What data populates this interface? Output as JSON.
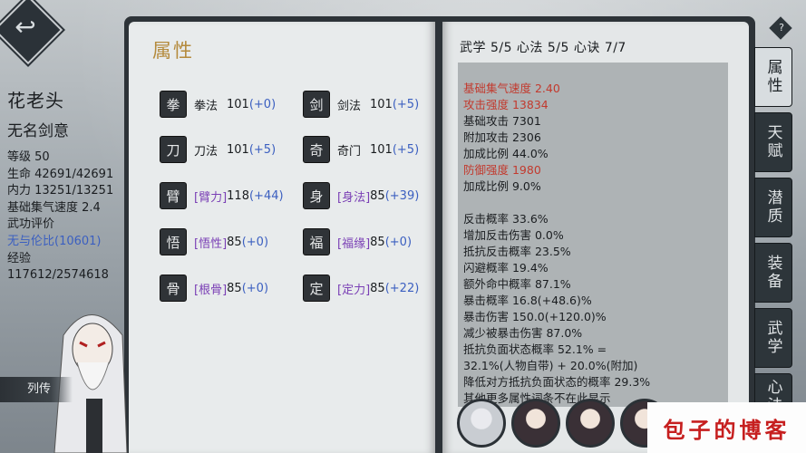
{
  "character": {
    "name": "花老头",
    "title": "无名剑意",
    "lines": [
      "等级 50",
      "生命 42691/42691",
      "内力 13251/13251",
      "基础集气速度 2.4",
      "武功评价",
      "无与伦比(10601)",
      "经验",
      "117612/2574618"
    ],
    "biography_label": "列传"
  },
  "attributes": {
    "title": "属性",
    "skills": [
      {
        "icon": "fist-icon",
        "glyph": "拳",
        "name": "拳法",
        "value": "101",
        "bonus": "(+0)",
        "special": false
      },
      {
        "icon": "sword-icon",
        "glyph": "剑",
        "name": "剑法",
        "value": "101",
        "bonus": "(+5)",
        "special": false
      },
      {
        "icon": "blade-icon",
        "glyph": "刀",
        "name": "刀法",
        "value": "101",
        "bonus": "(+5)",
        "special": false
      },
      {
        "icon": "odd-weapon-icon",
        "glyph": "奇",
        "name": "奇门",
        "value": "101",
        "bonus": "(+5)",
        "special": false
      },
      {
        "icon": "arm-strength-icon",
        "glyph": "臂",
        "name": "[臂力]",
        "value": "118",
        "bonus": "(+44)",
        "special": true
      },
      {
        "icon": "agility-icon",
        "glyph": "身",
        "name": "[身法]",
        "value": "85",
        "bonus": "(+39)",
        "special": true
      },
      {
        "icon": "comprehension-icon",
        "glyph": "悟",
        "name": "[悟性]",
        "value": "85",
        "bonus": "(+0)",
        "special": true
      },
      {
        "icon": "fortune-icon",
        "glyph": "福",
        "name": "[福缘]",
        "value": "85",
        "bonus": "(+0)",
        "special": true
      },
      {
        "icon": "root-bone-icon",
        "glyph": "骨",
        "name": "[根骨]",
        "value": "85",
        "bonus": "(+0)",
        "special": true
      },
      {
        "icon": "concentration-icon",
        "glyph": "定",
        "name": "[定力]",
        "value": "85",
        "bonus": "(+22)",
        "special": true
      }
    ]
  },
  "stats": {
    "header": "武学 5/5  心法 5/5  心诀 7/7",
    "lines": [
      {
        "text": "基础集气速度 2.40",
        "highlight": true
      },
      {
        "text": "攻击强度 13834",
        "highlight": true
      },
      {
        "text": " 基础攻击 7301",
        "highlight": false
      },
      {
        "text": " 附加攻击 2306",
        "highlight": false
      },
      {
        "text": "  加成比例 44.0%",
        "highlight": false
      },
      {
        "text": "防御强度 1980",
        "highlight": true
      },
      {
        "text": "  加成比例 9.0%",
        "highlight": false
      },
      {
        "text": "",
        "highlight": false
      },
      {
        "text": "反击概率 33.6%",
        "highlight": false
      },
      {
        "text": "增加反击伤害 0.0%",
        "highlight": false
      },
      {
        "text": "抵抗反击概率 23.5%",
        "highlight": false
      },
      {
        "text": "闪避概率 19.4%",
        "highlight": false
      },
      {
        "text": "额外命中概率 87.1%",
        "highlight": false
      },
      {
        "text": "暴击概率 16.8(+48.6)%",
        "highlight": false
      },
      {
        "text": "暴击伤害 150.0(+120.0)%",
        "highlight": false
      },
      {
        "text": "减少被暴击伤害 87.0%",
        "highlight": false
      },
      {
        "text": "抵抗负面状态概率 52.1% =",
        "highlight": false
      },
      {
        "text": "  32.1%(人物自带) + 20.0%(附加)",
        "highlight": false
      },
      {
        "text": "降低对方抵抗负面状态的概率 29.3%",
        "highlight": false
      },
      {
        "text": "其他更多属性词条不在此显示",
        "highlight": false
      }
    ]
  },
  "tabs": [
    "属性",
    "天赋",
    "潜质",
    "装备",
    "武学",
    "心法"
  ],
  "active_tab": 0,
  "help_label": "?",
  "watermark": "包子的博客",
  "colors": {
    "title_gold": "#b48a3c",
    "bonus_blue": "#3b5fc0",
    "special_purple": "#7a3fb5",
    "stat_red": "#c23a2e"
  }
}
